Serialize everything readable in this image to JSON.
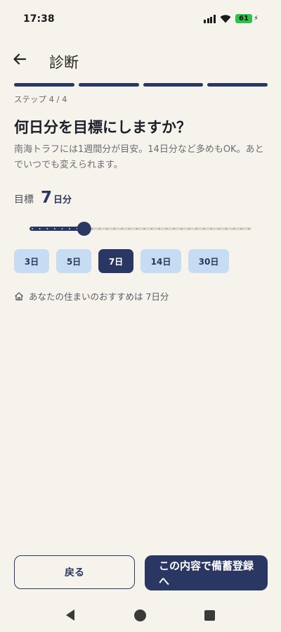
{
  "status": {
    "time": "17:38",
    "battery": "61",
    "icons": [
      "signal-icon",
      "wifi-icon",
      "battery-icon",
      "charging-icon"
    ]
  },
  "appbar": {
    "title": "診断",
    "back_icon": "arrow-left-icon"
  },
  "progress": {
    "current": 4,
    "total": 4
  },
  "step_label": "ステップ 4 / 4",
  "question": "何日分を目標にしますか？",
  "description": "南海トラフには1週間分が目安。14日分など多めもOK。あとでいつでも変えられます。",
  "target": {
    "label": "目標",
    "value": "7",
    "unit": "日分"
  },
  "slider": {
    "min": 1,
    "max": 30,
    "value": 7,
    "active_color": "#2b3763",
    "track_color": "#dcd6cb"
  },
  "chips": [
    {
      "label": "3日",
      "selected": false
    },
    {
      "label": "5日",
      "selected": false
    },
    {
      "label": "7日",
      "selected": true
    },
    {
      "label": "14日",
      "selected": false
    },
    {
      "label": "30日",
      "selected": false
    }
  ],
  "recommendation": {
    "icon": "home-icon",
    "text": "あなたの住まいのおすすめは 7日分"
  },
  "buttons": {
    "back_label": "戻る",
    "primary_label": "この内容で備蓄登録へ"
  },
  "colors": {
    "background": "#f6f2ec",
    "accent": "#2b3763",
    "chip": "#c5dcf2"
  }
}
